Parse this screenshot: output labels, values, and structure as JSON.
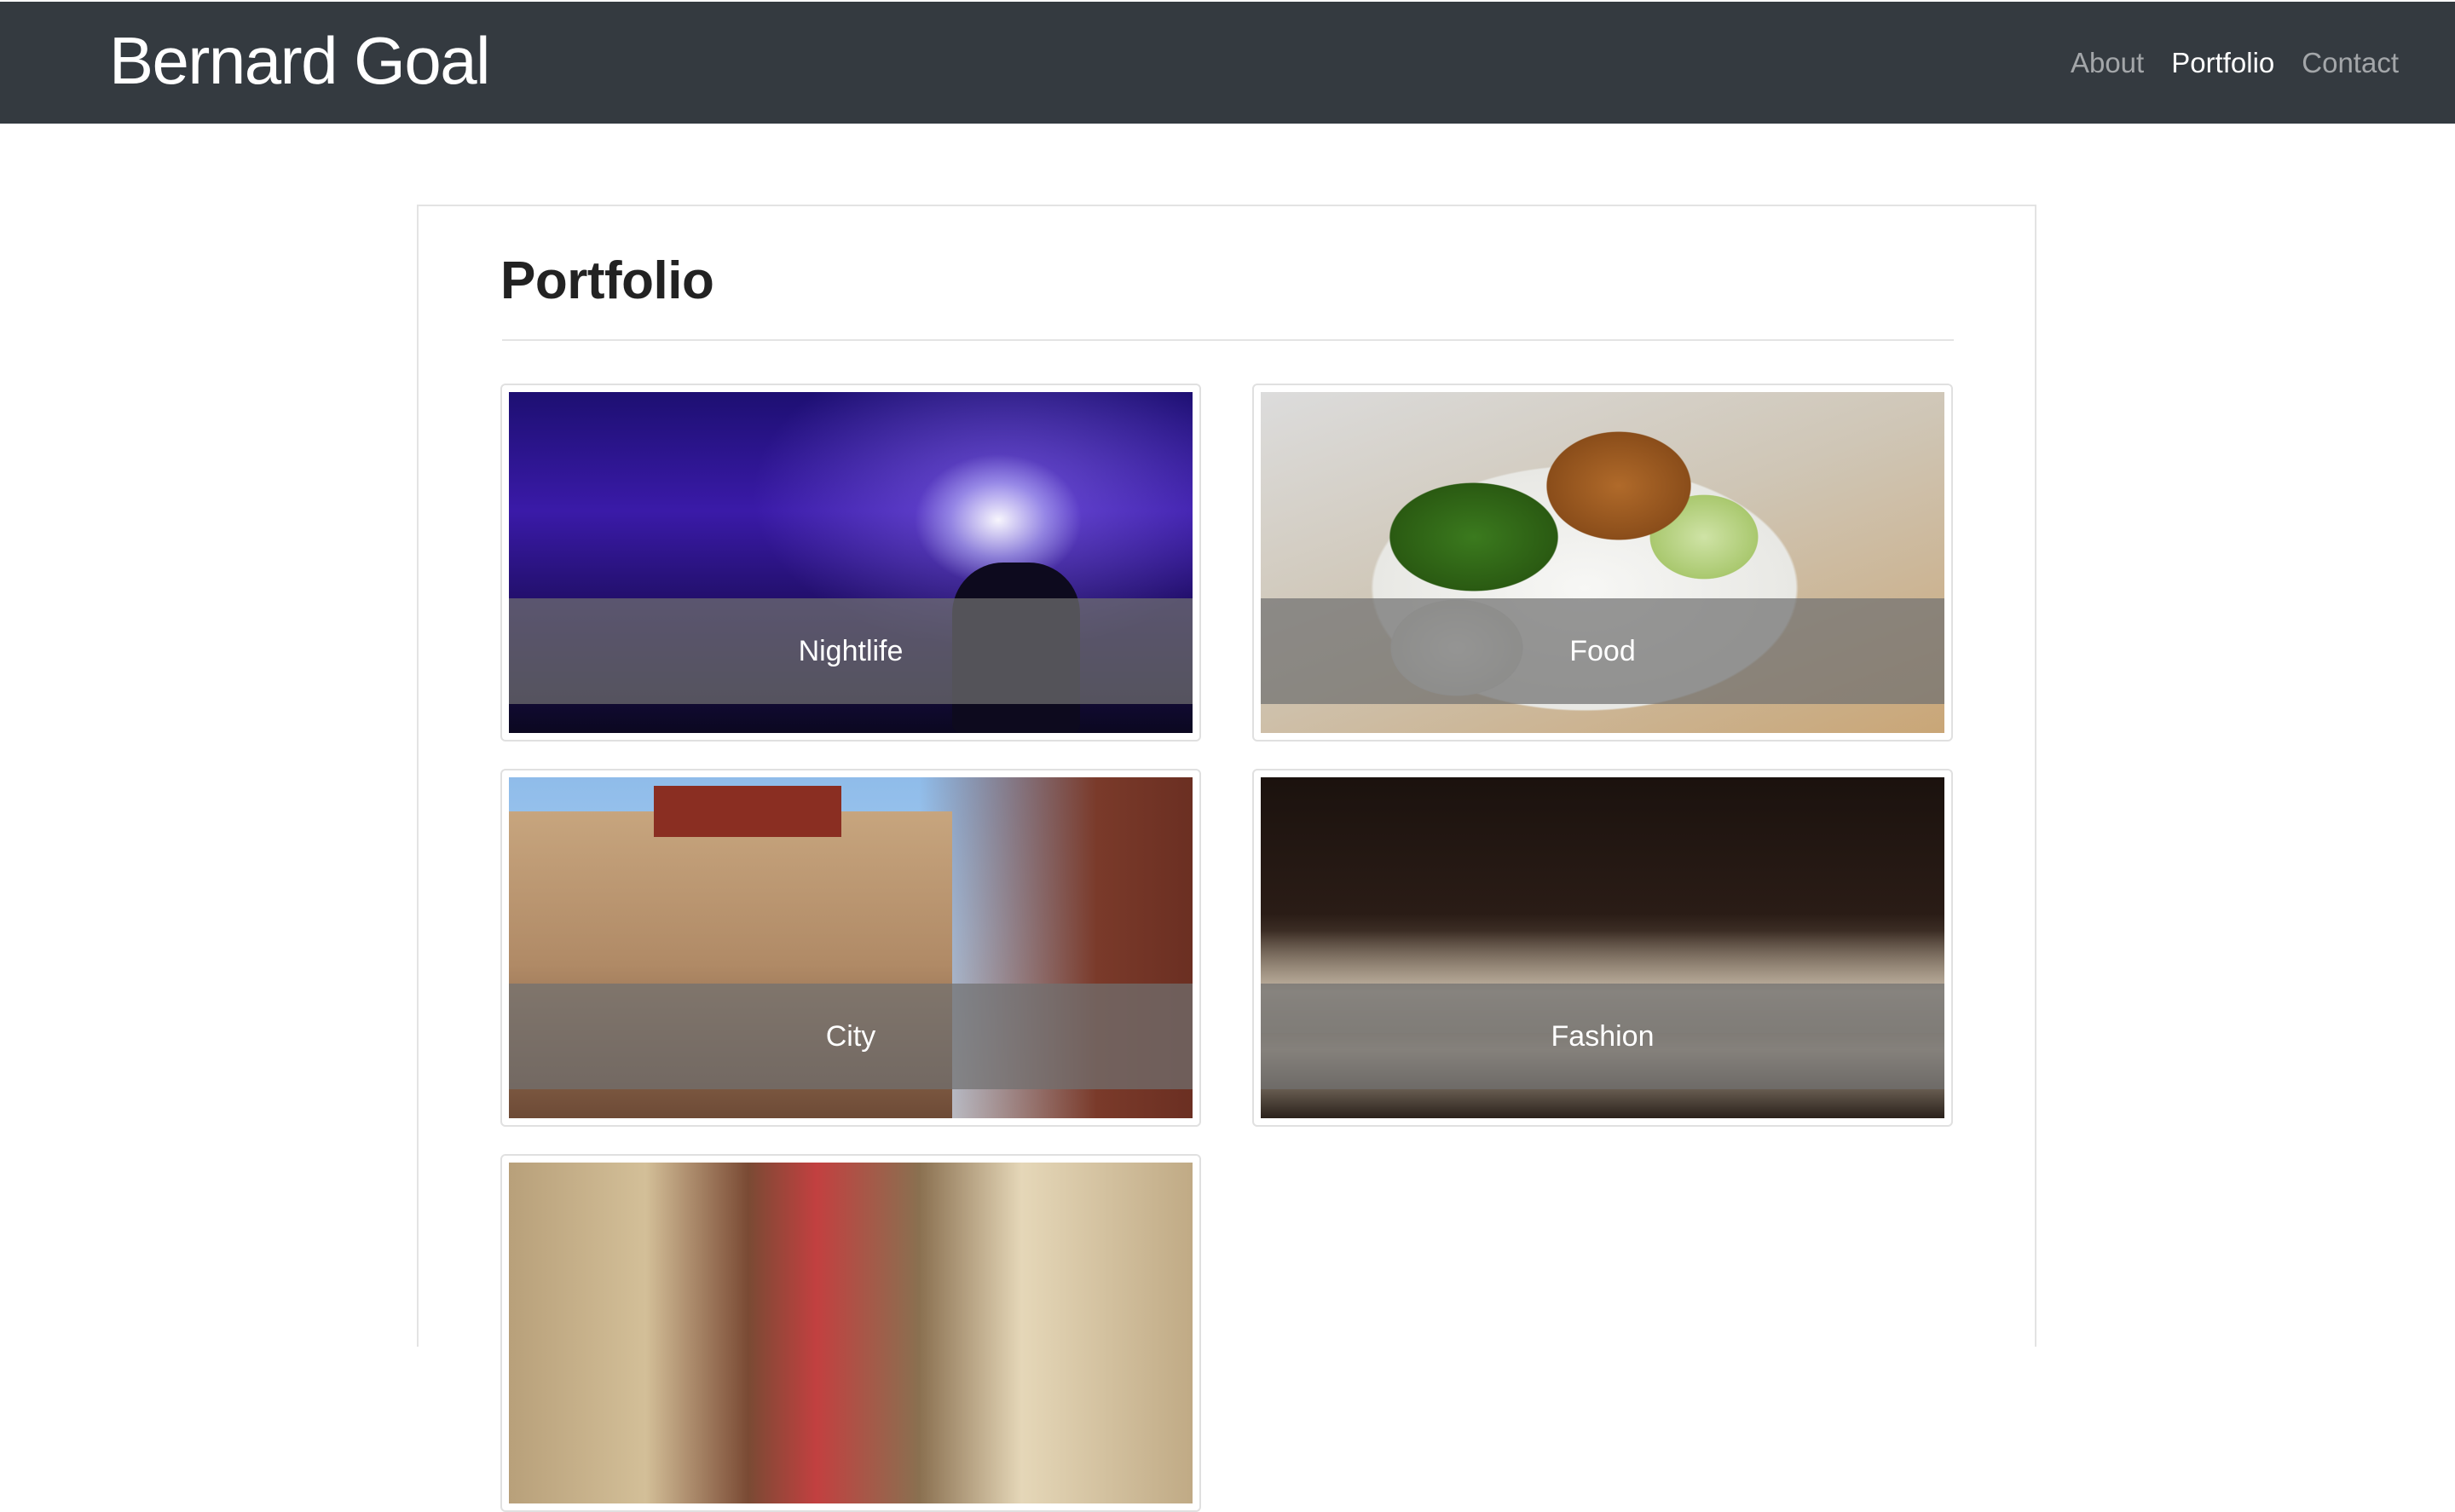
{
  "navbar": {
    "brand": "Bernard Goal",
    "links": [
      {
        "label": "About",
        "active": false
      },
      {
        "label": "Portfolio",
        "active": true
      },
      {
        "label": "Contact",
        "active": false
      }
    ],
    "background": "#343a40"
  },
  "main": {
    "title": "Portfolio",
    "items": [
      {
        "caption": "Nightlife",
        "image": "concert-dj-photo"
      },
      {
        "caption": "Food",
        "image": "bento-box-photo"
      },
      {
        "caption": "City",
        "image": "chinatown-street-photo"
      },
      {
        "caption": "Fashion",
        "image": "runway-show-photo"
      },
      {
        "caption": "",
        "image": "blurred-bus-photo"
      }
    ]
  }
}
